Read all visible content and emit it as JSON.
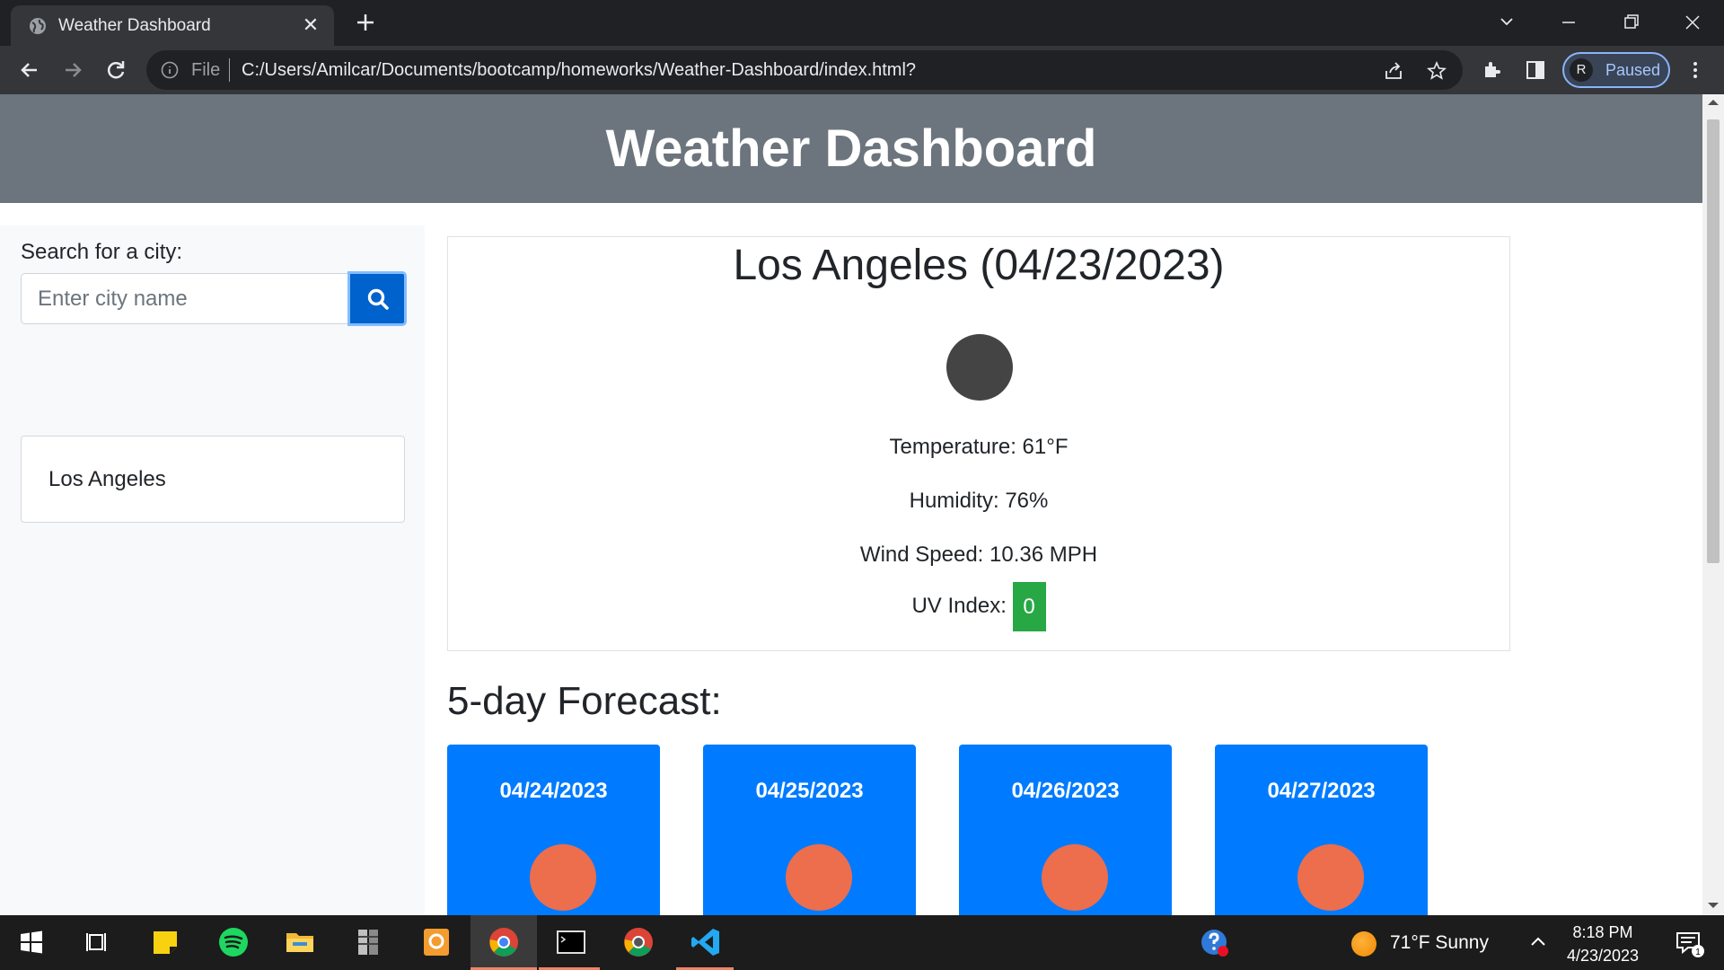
{
  "browser": {
    "tab_title": "Weather Dashboard",
    "tab_close": "✕",
    "url_scheme": "File",
    "url": "C:/Users/Amilcar/Documents/bootcamp/homeworks/Weather-Dashboard/index.html?",
    "profile_initial": "R",
    "profile_status": "Paused"
  },
  "page": {
    "header_title": "Weather Dashboard",
    "search_label": "Search for a city:",
    "search_placeholder": "Enter city name",
    "history": [
      "Los Angeles"
    ],
    "current": {
      "city_date": "Los Angeles (04/23/2023)",
      "temperature": "Temperature: 61°F",
      "humidity": "Humidity: 76%",
      "wind": "Wind Speed: 10.36 MPH",
      "uv_label": "UV Index:",
      "uv_value": "0",
      "uv_color": "#28a745"
    },
    "forecast_title": "5-day Forecast:",
    "forecast": [
      {
        "date": "04/24/2023"
      },
      {
        "date": "04/25/2023"
      },
      {
        "date": "04/26/2023"
      },
      {
        "date": "04/27/2023"
      }
    ]
  },
  "taskbar": {
    "weather": "71°F  Sunny",
    "time": "8:18 PM",
    "date": "4/23/2023",
    "notifications": "1"
  },
  "colors": {
    "header_bg": "#6c757d",
    "card_bg": "#007bff",
    "search_btn": "#0062cc"
  }
}
